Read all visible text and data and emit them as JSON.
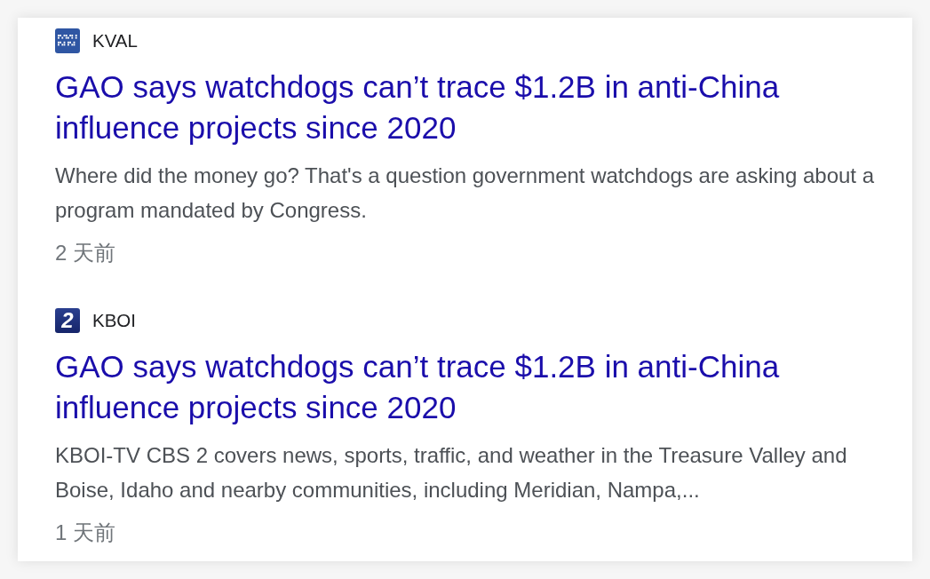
{
  "articles": [
    {
      "source": {
        "name": "KVAL",
        "logo": {
          "kind": "grid"
        }
      },
      "title": "GAO says watchdogs can’t trace $1.2B in anti-China influence projects since 2020",
      "snippet": "Where did the money go? That's a question government watchdogs are asking about a program mandated by Congress.",
      "time": "2 天前"
    },
    {
      "source": {
        "name": "KBOI",
        "logo": {
          "kind": "numeral",
          "text": "2"
        }
      },
      "title": "GAO says watchdogs can’t trace $1.2B in anti-China influence projects since 2020",
      "snippet": "KBOI-TV CBS 2 covers news, sports, traffic, and weather in the Treasure Valley and Boise, Idaho and nearby communities, including Meridian, Nampa,...",
      "time": "1 天前"
    }
  ]
}
